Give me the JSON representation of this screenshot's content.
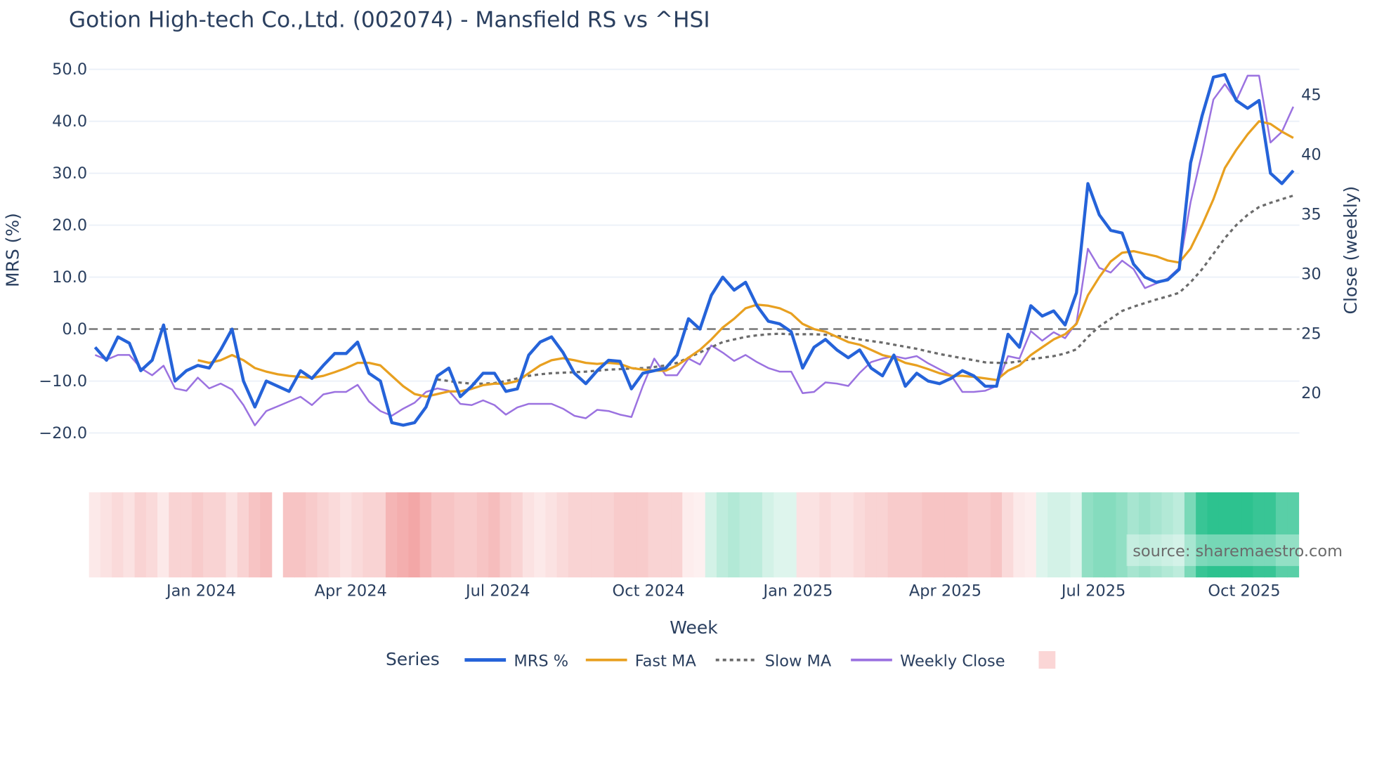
{
  "chart_data": {
    "type": "line",
    "title": "Gotion High-tech Co.,Ltd. (002074) - Mansfield RS vs ^HSI",
    "xlabel": "Week",
    "ylabel": "MRS (%)",
    "y2label": "Close (weekly)",
    "ylim": [
      -23,
      52
    ],
    "y2lim": [
      16.5,
      48
    ],
    "yticks": [
      "50.0",
      "40.0",
      "30.0",
      "20.0",
      "10.0",
      "0.0",
      "−10.0",
      "−20.0"
    ],
    "ytick_values": [
      50,
      40,
      30,
      20,
      10,
      0,
      -10,
      -20
    ],
    "y2ticks": [
      "45",
      "40",
      "35",
      "30",
      "25",
      "20"
    ],
    "y2tick_values": [
      45,
      40,
      35,
      30,
      25,
      20
    ],
    "xticks": [
      {
        "label": "Jan 2024",
        "at_week": 9.3
      },
      {
        "label": "Apr 2024",
        "at_week": 22.4
      },
      {
        "label": "Jul 2024",
        "at_week": 35.3
      },
      {
        "label": "Oct 2024",
        "at_week": 48.5
      },
      {
        "label": "Jan 2025",
        "at_week": 61.6
      },
      {
        "label": "Apr 2025",
        "at_week": 74.5
      },
      {
        "label": "Jul 2025",
        "at_week": 87.5
      },
      {
        "label": "Oct 2025",
        "at_week": 100.7
      }
    ],
    "zero_line": 0,
    "series": [
      {
        "name": "MRS %",
        "color": "#2563d9",
        "axis": "left",
        "values": [
          -3.5,
          -6,
          -1.5,
          -2.7,
          -8,
          -6,
          0.8,
          -10,
          -8,
          -7,
          -7.5,
          -4,
          0,
          -10,
          -15,
          -10,
          -11,
          -12,
          -8,
          -9.5,
          -7,
          -4.7,
          -4.7,
          -2.5,
          -8.5,
          -10,
          -18,
          -18.5,
          -18,
          -15,
          -9,
          -7.5,
          -13,
          -11,
          -8.5,
          -8.5,
          -12,
          -11.5,
          -5,
          -2.5,
          -1.5,
          -4.5,
          -8.5,
          -10.5,
          -8,
          -6,
          -6.2,
          -11.5,
          -8.5,
          -8,
          -7.5,
          -5,
          2,
          0,
          6.5,
          10,
          7.5,
          9,
          4.5,
          1.5,
          1,
          -0.5,
          -7.5,
          -3.5,
          -2,
          -4,
          -5.5,
          -4,
          -7.5,
          -9,
          -5,
          -11,
          -8.5,
          -10,
          -10.5,
          -9.5,
          -8,
          -9,
          -11,
          -11,
          -1,
          -3.5,
          4.5,
          2.5,
          3.5,
          0.8,
          7,
          28,
          22,
          19,
          18.5,
          12.5,
          10,
          9,
          9.5,
          11.5,
          32,
          41,
          48.5,
          49,
          44,
          42.5,
          44,
          30,
          28,
          30.5
        ]
      },
      {
        "name": "Fast MA",
        "color": "#e8a020",
        "axis": "left",
        "values": [
          null,
          null,
          null,
          null,
          null,
          null,
          null,
          null,
          null,
          -6,
          -6.5,
          -6,
          -5,
          -6,
          -7.5,
          -8.2,
          -8.7,
          -9,
          -9.2,
          -9.4,
          -9,
          -8.3,
          -7.5,
          -6.5,
          -6.5,
          -7,
          -9,
          -11,
          -12.5,
          -13,
          -12.5,
          -12,
          -12,
          -11.5,
          -10.8,
          -10.5,
          -10.5,
          -10,
          -8.5,
          -7,
          -6,
          -5.6,
          -6,
          -6.5,
          -6.7,
          -6.5,
          -6.7,
          -7.5,
          -7.8,
          -8,
          -8,
          -7,
          -5.5,
          -4,
          -2,
          0.3,
          2,
          4,
          4.7,
          4.5,
          4,
          3,
          1,
          0,
          -0.5,
          -1.5,
          -2.5,
          -3,
          -4,
          -5,
          -5.5,
          -6.5,
          -7,
          -7.7,
          -8.5,
          -9,
          -9,
          -9.2,
          -9.5,
          -9.8,
          -8,
          -7,
          -5,
          -3.5,
          -2,
          -1,
          1,
          6.5,
          10,
          13,
          14.7,
          15,
          14.5,
          14,
          13.2,
          12.8,
          15.5,
          20,
          25,
          31,
          34.5,
          37.5,
          40,
          39.5,
          38,
          36.8
        ]
      },
      {
        "name": "Slow MA",
        "color": "#6b6b6b",
        "axis": "left",
        "dash": "dot",
        "values": [
          null,
          null,
          null,
          null,
          null,
          null,
          null,
          null,
          null,
          null,
          null,
          null,
          null,
          null,
          null,
          null,
          null,
          null,
          null,
          null,
          null,
          null,
          null,
          null,
          null,
          null,
          null,
          null,
          null,
          null,
          -9.7,
          -10,
          -10.3,
          -10.5,
          -10.5,
          -10.4,
          -10,
          -9.5,
          -9,
          -8.7,
          -8.5,
          -8.4,
          -8.3,
          -8.2,
          -8,
          -7.8,
          -7.7,
          -7.6,
          -7.5,
          -7.3,
          -7,
          -6.5,
          -5.5,
          -4.5,
          -3.5,
          -2.5,
          -2,
          -1.5,
          -1.2,
          -1,
          -0.9,
          -1,
          -1,
          -1,
          -1.1,
          -1.3,
          -1.6,
          -2,
          -2.3,
          -2.6,
          -3,
          -3.4,
          -3.8,
          -4.3,
          -4.8,
          -5.2,
          -5.6,
          -6,
          -6.4,
          -6.5,
          -6.5,
          -6.2,
          -5.8,
          -5.5,
          -5.2,
          -4.7,
          -3.9,
          -1.5,
          0.5,
          2,
          3.5,
          4.3,
          5,
          5.7,
          6.3,
          7,
          9,
          11.5,
          14.5,
          17.5,
          20,
          22,
          23.5,
          24.3,
          25,
          25.7
        ]
      },
      {
        "name": "Weekly Close",
        "color": "#9b72e0",
        "axis": "right",
        "values": [
          23.2,
          22.8,
          23.2,
          23.2,
          22.1,
          21.5,
          22.3,
          20.4,
          20.2,
          21.3,
          20.4,
          20.8,
          20.3,
          19,
          17.3,
          18.5,
          18.9,
          19.3,
          19.7,
          19,
          19.9,
          20.1,
          20.1,
          20.7,
          19.3,
          18.5,
          18.1,
          18.7,
          19.2,
          20.1,
          20.4,
          20.2,
          19.1,
          19,
          19.4,
          19,
          18.2,
          18.8,
          19.1,
          19.1,
          19.1,
          18.7,
          18.1,
          17.9,
          18.6,
          18.5,
          18.2,
          18,
          20.6,
          22.9,
          21.5,
          21.5,
          22.9,
          22.4,
          24,
          23.4,
          22.7,
          23.2,
          22.6,
          22.1,
          21.8,
          21.8,
          20,
          20.1,
          20.9,
          20.8,
          20.6,
          21.7,
          22.6,
          22.9,
          23.1,
          22.9,
          23.1,
          22.5,
          22,
          21.5,
          20.1,
          20.1,
          20.2,
          20.6,
          23.1,
          22.9,
          25.2,
          24.4,
          25.1,
          24.6,
          25.9,
          32.1,
          30.5,
          30.1,
          31.1,
          30.4,
          28.8,
          29.2,
          29.6,
          30.5,
          36,
          40.1,
          44.6,
          45.9,
          44.5,
          46.6,
          46.6,
          41,
          41.9,
          44
        ]
      }
    ],
    "heatmap": {
      "neg_color": "#ee7f7f",
      "pos_color": "#22bf89",
      "values": [
        -0.15,
        -0.2,
        -0.25,
        -0.2,
        -0.3,
        -0.25,
        -0.15,
        -0.3,
        -0.3,
        -0.35,
        -0.3,
        -0.3,
        -0.2,
        -0.3,
        -0.4,
        -0.45,
        null,
        -0.4,
        -0.4,
        -0.35,
        -0.3,
        -0.25,
        -0.2,
        -0.25,
        -0.3,
        -0.3,
        -0.5,
        -0.55,
        -0.6,
        -0.5,
        -0.4,
        -0.4,
        -0.35,
        -0.35,
        -0.4,
        -0.45,
        -0.35,
        -0.3,
        -0.2,
        -0.15,
        -0.2,
        -0.25,
        -0.3,
        -0.3,
        -0.3,
        -0.3,
        -0.35,
        -0.35,
        -0.35,
        -0.3,
        -0.3,
        -0.3,
        -0.12,
        -0.1,
        0.2,
        0.3,
        0.35,
        0.3,
        0.3,
        0.2,
        0.15,
        0.15,
        -0.2,
        -0.2,
        -0.25,
        -0.2,
        -0.2,
        -0.25,
        -0.3,
        -0.3,
        -0.35,
        -0.35,
        -0.35,
        -0.4,
        -0.4,
        -0.4,
        -0.4,
        -0.35,
        -0.35,
        -0.4,
        -0.25,
        -0.15,
        -0.12,
        0.15,
        0.2,
        0.2,
        0.15,
        0.5,
        0.55,
        0.55,
        0.5,
        0.4,
        0.45,
        0.4,
        0.35,
        0.3,
        0.6,
        0.9,
        0.95,
        0.95,
        0.95,
        0.95,
        0.9,
        0.9,
        0.75,
        0.75
      ]
    },
    "legend": {
      "title": "Series",
      "placement": "bottom"
    },
    "annotation": "source: sharemaestro.com"
  }
}
